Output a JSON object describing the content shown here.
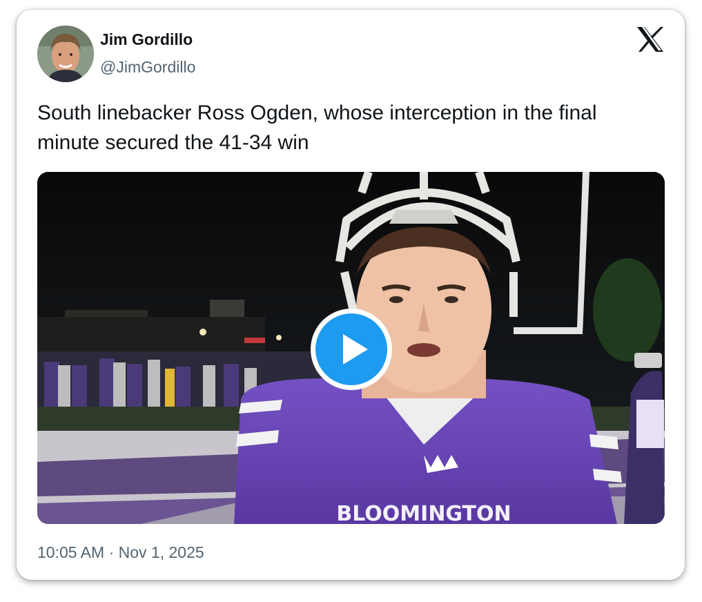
{
  "author": {
    "name": "Jim Gordillo",
    "handle": "@JimGordillo",
    "avatar_icon": "user-avatar"
  },
  "brand": {
    "logo_icon": "x-logo-icon"
  },
  "tweet": {
    "text": "South linebacker Ross Ogden, whose interception in the final minute secured the 41-34 win"
  },
  "media": {
    "type": "video",
    "jersey_text": "BLOOMINGTON",
    "play_icon": "play-icon",
    "accent_color": "#1d9bf0",
    "jersey_color": "#6a45b3"
  },
  "meta": {
    "timestamp": "10:05 AM · Nov 1, 2025"
  }
}
